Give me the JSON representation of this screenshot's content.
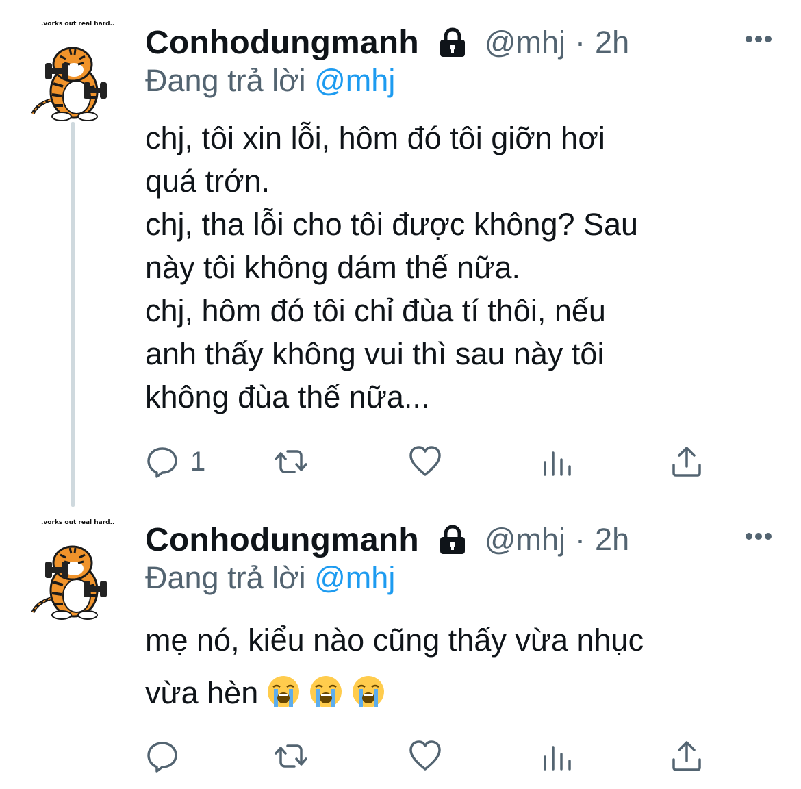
{
  "tweets": [
    {
      "avatar_caption": ".vorks out real hard..",
      "display_name": "Conhodungmanh",
      "handle": "@mhj",
      "separator": "·",
      "time": "2h",
      "reply_prefix": "Đang trả lời",
      "reply_mention": "@mhj",
      "text": "chj, tôi xin lỗi, hôm đó tôi giỡn hơi\nquá trớn.\nchj, tha lỗi cho tôi được không? Sau\nnày tôi không dám thế nữa.\nchj, hôm đó tôi chỉ đùa tí thôi, nếu\nanh thấy không vui thì sau này tôi\nkhông đùa thế nữa...",
      "reply_count": "1"
    },
    {
      "avatar_caption": ".vorks out real hard..",
      "display_name": "Conhodungmanh",
      "handle": "@mhj",
      "separator": "·",
      "time": "2h",
      "reply_prefix": "Đang trả lời",
      "reply_mention": "@mhj",
      "text_line1": "mẹ nó, kiểu nào cũng thấy vừa nhục",
      "text_line2": "vừa hèn",
      "emoji_name": "loudly-crying-face",
      "reply_count": ""
    }
  ],
  "colors": {
    "text": "#0f1419",
    "secondary": "#536471",
    "link": "#1d9bf0",
    "thread_line": "#cfd9de"
  },
  "icons": [
    "lock-icon",
    "more-icon",
    "reply-icon",
    "retweet-icon",
    "like-icon",
    "views-icon",
    "share-icon"
  ]
}
